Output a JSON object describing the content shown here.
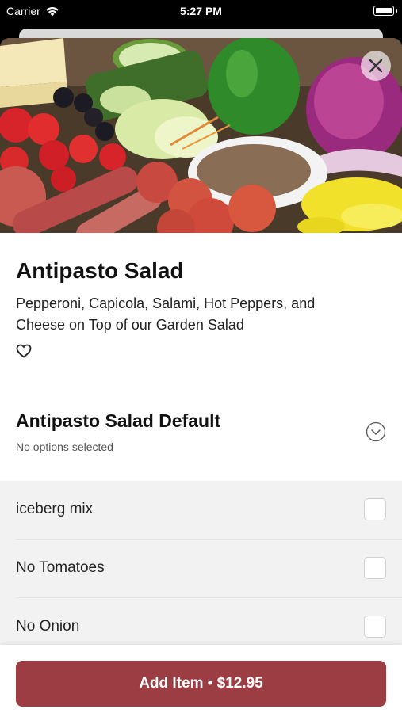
{
  "status_bar": {
    "carrier": "Carrier",
    "time": "5:27 PM"
  },
  "item": {
    "title": "Antipasto Salad",
    "description": "Pepperoni, Capicola, Salami, Hot Peppers, and Cheese on Top of our Garden Salad",
    "image_icon": "salad-photo"
  },
  "modifier_group": {
    "title": "Antipasto Salad Default",
    "subtitle": "No options selected",
    "options": [
      {
        "label": "iceberg mix",
        "checked": false
      },
      {
        "label": "No Tomatoes",
        "checked": false
      },
      {
        "label": "No Onion",
        "checked": false
      }
    ]
  },
  "footer": {
    "add_label": "Add Item • $12.95"
  },
  "colors": {
    "accent": "#9b3d42",
    "options_bg": "#f2f2f2"
  }
}
